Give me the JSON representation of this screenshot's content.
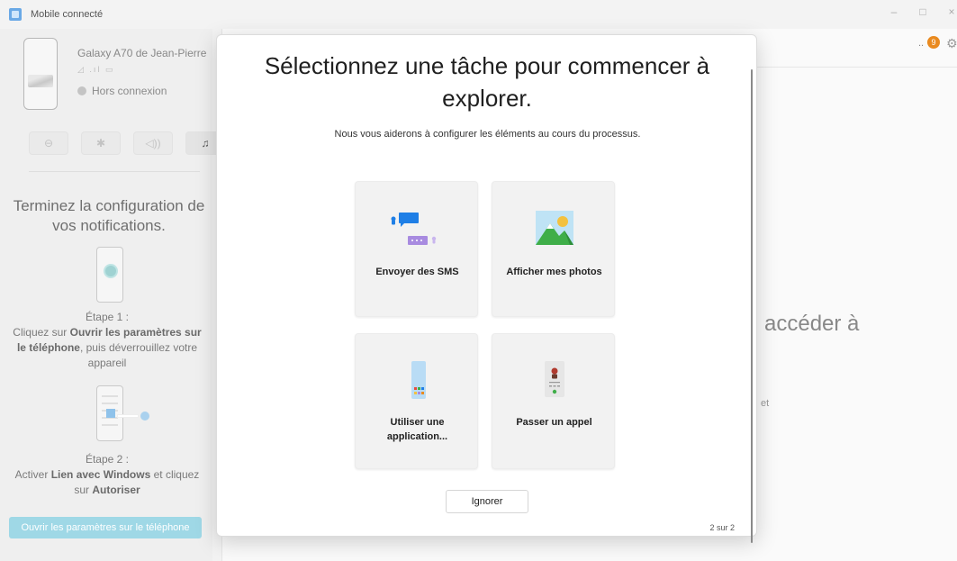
{
  "window": {
    "title": "Mobile connecté",
    "controls": [
      "–",
      "□",
      "×"
    ]
  },
  "device": {
    "name": "Galaxy A70 de Jean-Pierre",
    "signal": "◿ .ıl ▭",
    "status": "Hors connexion"
  },
  "quick_actions": [
    {
      "icon": "minus-circle-icon",
      "glyph": "⊖"
    },
    {
      "icon": "bluetooth-icon",
      "glyph": "✱"
    },
    {
      "icon": "volume-icon",
      "glyph": "◁))"
    },
    {
      "icon": "music-note-icon",
      "glyph": "♫"
    }
  ],
  "setup": {
    "title": "Terminez la configuration de vos notifications.",
    "step1_label": "Étape 1 :",
    "step1_pre": "Cliquez sur ",
    "step1_bold": "Ouvrir les paramètres sur le téléphone",
    "step1_post": ", puis déverrouillez votre appareil",
    "step2_label": "Étape 2 :",
    "step2_pre": "Activer ",
    "step2_bold1": "Lien avec Windows",
    "step2_mid": " et cliquez sur ",
    "step2_bold2": "Autoriser",
    "button": "Ouvrir les paramètres sur le téléphone"
  },
  "right": {
    "badge": "9",
    "dots": "..",
    "bg_text_large": "accéder à",
    "bg_text_small": "et"
  },
  "modal": {
    "title": "Sélectionnez une tâche pour commencer à explorer.",
    "subtitle": "Nous vous aiderons à configurer les éléments au cours du processus.",
    "tasks": [
      {
        "label": "Envoyer des SMS",
        "icon": "messages-icon"
      },
      {
        "label": "Afficher mes photos",
        "icon": "photos-icon"
      },
      {
        "label": "Utiliser une application...",
        "icon": "apps-icon"
      },
      {
        "label": "Passer un appel",
        "icon": "call-icon"
      }
    ],
    "ignore_button": "Ignorer",
    "page_indicator": "2 sur 2"
  },
  "colors": {
    "accent_blue": "#1f7fe6",
    "message_purple": "#a88be0",
    "photo_green": "#3fae49",
    "button_disabled": "#9fd8e6",
    "badge_orange": "#e98a1f"
  }
}
